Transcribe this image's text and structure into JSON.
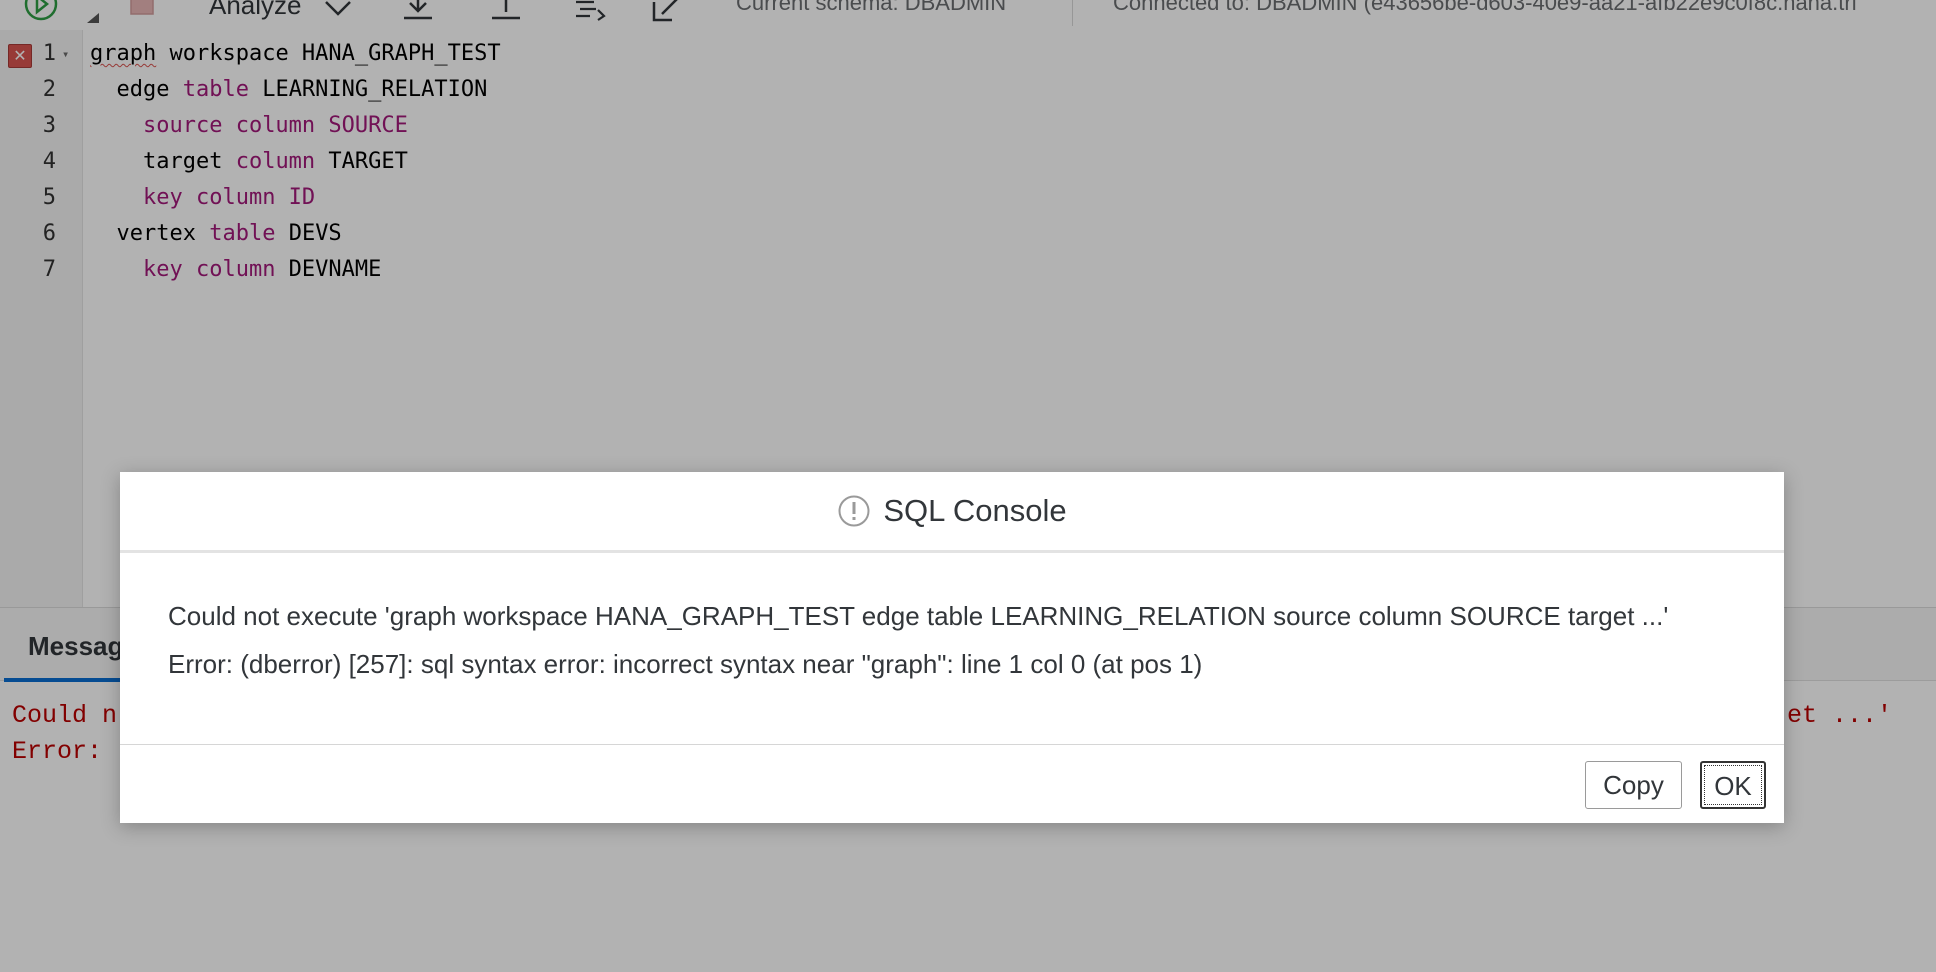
{
  "toolbar": {
    "analyze_label": "Analyze",
    "schema_status": "Current schema: DBADMIN",
    "connection_status": "Connected to: DBADMIN (e43656be-d603-40e9-aa21-afb22e9c0f8c.hana.tri"
  },
  "editor": {
    "lines": [
      {
        "num": "1",
        "text": "graph workspace HANA_GRAPH_TEST"
      },
      {
        "num": "2",
        "text": "edge table LEARNING_RELATION"
      },
      {
        "num": "3",
        "text": "source column SOURCE"
      },
      {
        "num": "4",
        "text": "target column TARGET"
      },
      {
        "num": "5",
        "text": "key column ID"
      },
      {
        "num": "6",
        "text": "vertex table DEVS"
      },
      {
        "num": "7",
        "text": "key column DEVNAME"
      }
    ]
  },
  "panel": {
    "tab_label": "Messages",
    "visible_prefix_1": "Could n",
    "visible_prefix_2": "Error: ",
    "visible_tail_1": "et ...'"
  },
  "dialog": {
    "title": "SQL Console",
    "message_line1": "Could not execute 'graph workspace HANA_GRAPH_TEST edge table LEARNING_RELATION source column SOURCE target ...'",
    "message_line2": "Error: (dberror) [257]: sql syntax error: incorrect syntax near \"graph\": line 1 col 0 (at pos 1)",
    "copy_label": "Copy",
    "ok_label": "OK"
  },
  "colors": {
    "keyword": "#a3197a",
    "error_text": "#bb0000",
    "run_icon": "#2e9e44",
    "accent": "#0a6ed1"
  },
  "icons": [
    "run-icon",
    "stop-icon",
    "chevron-down-icon",
    "download-icon",
    "upload-icon",
    "format-icon",
    "edit-icon",
    "error-marker-icon",
    "fold-icon",
    "warning-icon"
  ]
}
